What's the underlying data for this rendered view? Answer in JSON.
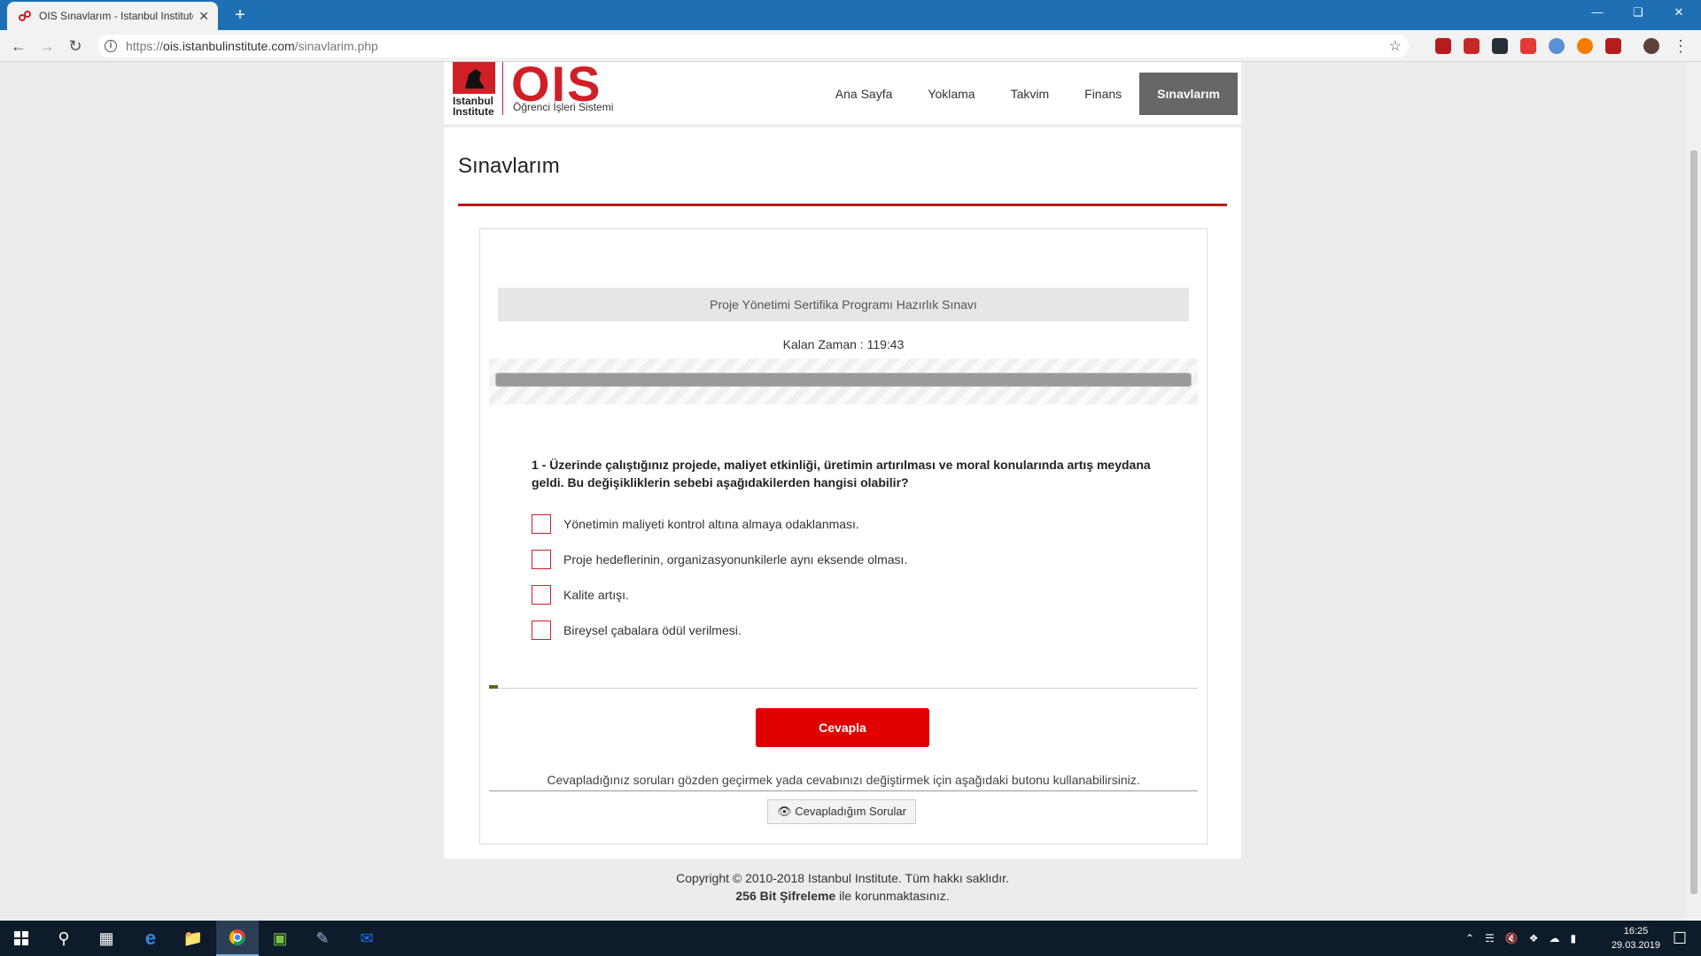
{
  "browser": {
    "tab_title": "OIS Sınavlarım - Istanbul Institute",
    "new_tab": "+",
    "url_scheme": "https://",
    "url_host": "ois.istanbulinstitute.com",
    "url_path": "/sinavlarim.php"
  },
  "header": {
    "logo_top": "Istanbul",
    "logo_bottom": "Institute",
    "logo_brand": "OIS",
    "logo_subtitle": "Öğrenci İşleri Sistemi",
    "nav": [
      "Ana Sayfa",
      "Yoklama",
      "Takvim",
      "Finans",
      "Sınavlarım"
    ],
    "active_nav": "Sınavlarım"
  },
  "page": {
    "title": "Sınavlarım",
    "exam_title": "Proje Yönetimi Sertifika Programı Hazırlık Sınavı",
    "timer_label": "Kalan Zaman : 119:43",
    "progress_fraction": 1.0,
    "question": "1 - Üzerinde çalıştığınız projede, maliyet etkinliği, üretimin artırılması ve moral konularında artış meydana geldi. Bu değişikliklerin sebebi aşağıdakilerden hangisi olabilir?",
    "options": [
      "Yönetimin maliyeti kontrol altına almaya odaklanması.",
      "Proje hedeflerinin, organizasyonunkilerle aynı eksende olması.",
      "Kalite artışı.",
      "Bireysel çabalara ödül verilmesi."
    ],
    "answer_button": "Cevapla",
    "review_text": "Cevapladığınız soruları gözden geçirmek yada cevabınızı değiştirmek için aşağıdaki butonu kullanabilirsiniz.",
    "review_button": "Cevapladığım Sorular"
  },
  "footer": {
    "line1": "Copyright © 2010-2018 Istanbul Institute. Tüm hakkı saklıdır.",
    "line2_bold": "256 Bit Şifreleme",
    "line2_rest": " ile korunmaktasınız."
  },
  "taskbar": {
    "time": "16:25",
    "date": "29.03.2019"
  },
  "colors": {
    "brand_red": "#d01f26",
    "chrome_blue": "#1f6fb5",
    "active_nav": "#666666"
  }
}
